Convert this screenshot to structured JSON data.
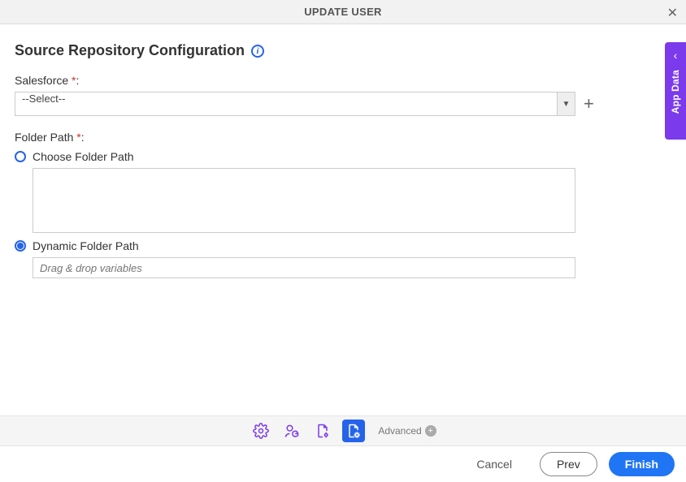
{
  "header": {
    "title": "UPDATE USER"
  },
  "sideTab": {
    "label": "App Data"
  },
  "section": {
    "title": "Source Repository Configuration"
  },
  "salesforce": {
    "label": "Salesforce",
    "value": "--Select--"
  },
  "folderPath": {
    "label": "Folder Path"
  },
  "radios": {
    "choose": {
      "label": "Choose Folder Path"
    },
    "dynamic": {
      "label": "Dynamic Folder Path",
      "placeholder": "Drag & drop variables"
    }
  },
  "advanced": {
    "label": "Advanced"
  },
  "footer": {
    "cancel": "Cancel",
    "prev": "Prev",
    "finish": "Finish"
  }
}
